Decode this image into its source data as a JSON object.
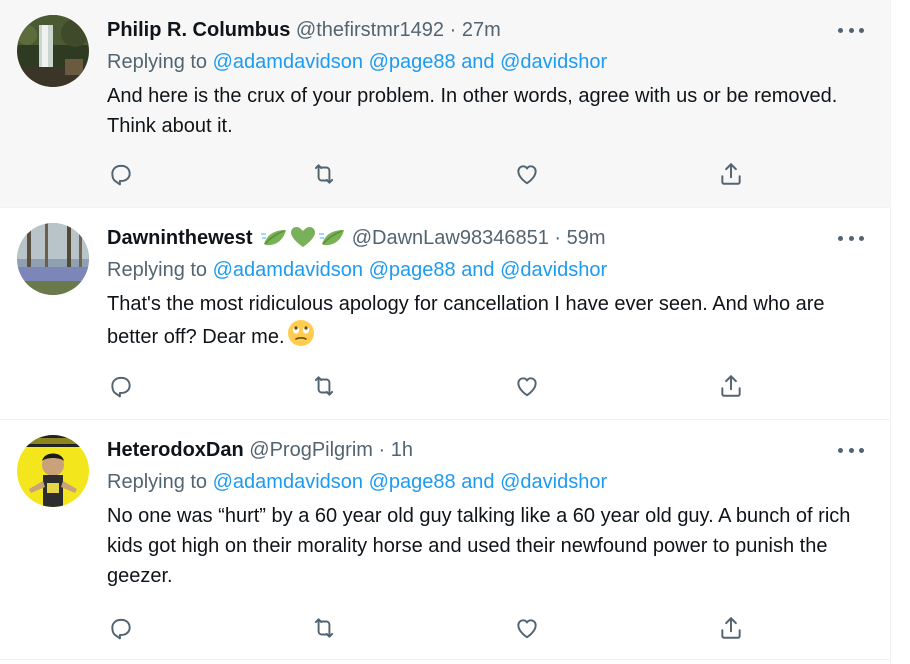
{
  "colors": {
    "accent": "#1d9bf0",
    "secondary": "#536471",
    "text": "#0f1419"
  },
  "tweets": [
    {
      "name": "Philip R. Columbus",
      "handle": "@thefirstmr1492",
      "sep": "·",
      "time": "27m",
      "replying_prefix": "Replying to",
      "mentions": [
        "@adamdavidson",
        "@page88",
        "@davidshor"
      ],
      "and": "and",
      "text": "And here is the crux of your problem. In other words, agree with us or be removed. Think about it."
    },
    {
      "name": "Dawninthewest",
      "name_emojis": [
        "leaf-flutter-icon",
        "green-heart-icon",
        "leaf-flutter-icon"
      ],
      "handle": "@DawnLaw98346851",
      "sep": "·",
      "time": "59m",
      "replying_prefix": "Replying to",
      "mentions": [
        "@adamdavidson",
        "@page88",
        "@davidshor"
      ],
      "and": "and",
      "text": "That's the most ridiculous apology for cancellation I have ever seen.  And who are better off? Dear me.",
      "trailing_emoji": "eye-roll-face-icon"
    },
    {
      "name": "HeterodoxDan",
      "handle": "@ProgPilgrim",
      "sep": "·",
      "time": "1h",
      "replying_prefix": "Replying to",
      "mentions": [
        "@adamdavidson",
        "@page88",
        "@davidshor"
      ],
      "and": "and",
      "text": "No one was “hurt” by a 60 year old guy talking like a 60 year old guy.  A bunch of rich kids got high on their morality horse and used their newfound power to punish the geezer."
    }
  ],
  "action_icons": [
    "reply-icon",
    "retweet-icon",
    "like-icon",
    "share-icon"
  ]
}
